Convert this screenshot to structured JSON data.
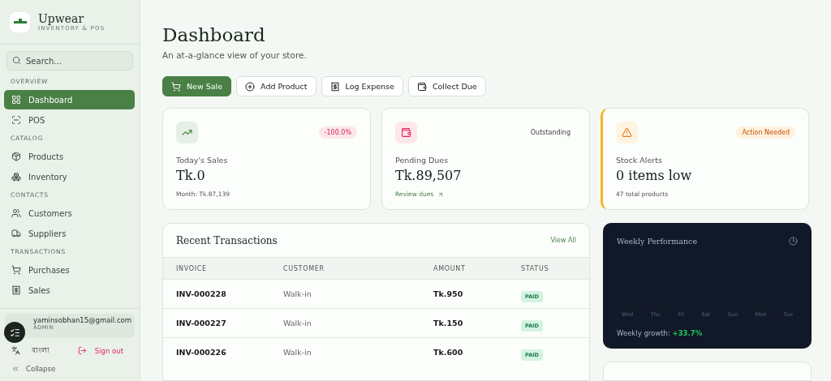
{
  "brand": {
    "name": "Upwear",
    "tagline": "INVENTORY & POS"
  },
  "search": {
    "placeholder": "Search..."
  },
  "nav": [
    {
      "section": "OVERVIEW",
      "items": [
        {
          "label": "Dashboard",
          "selected": true
        },
        {
          "label": "POS",
          "selected": false
        }
      ]
    },
    {
      "section": "CATALOG",
      "items": [
        {
          "label": "Products",
          "selected": false
        },
        {
          "label": "Inventory",
          "selected": false
        }
      ]
    },
    {
      "section": "CONTACTS",
      "items": [
        {
          "label": "Customers",
          "selected": false
        },
        {
          "label": "Suppliers",
          "selected": false
        }
      ]
    },
    {
      "section": "TRANSACTIONS",
      "items": [
        {
          "label": "Purchases",
          "selected": false
        },
        {
          "label": "Sales",
          "selected": false
        }
      ]
    }
  ],
  "user": {
    "email": "yaminsobhan15@gmail.com",
    "role": "ADMIN"
  },
  "language": "বাংলা",
  "sign_out": "Sign out",
  "collapse": "Collapse",
  "page": {
    "title": "Dashboard",
    "subtitle": "An at-a-glance view of your store."
  },
  "actions": [
    {
      "label": "New Sale",
      "kind": "primary"
    },
    {
      "label": "Add Product",
      "kind": "secondary"
    },
    {
      "label": "Log Expense",
      "kind": "secondary"
    },
    {
      "label": "Collect Due",
      "kind": "secondary"
    }
  ],
  "stats": [
    {
      "kind": "sales",
      "badge": "-100.0%",
      "label": "Today's Sales",
      "value": "Tk.0",
      "footer": "Month: Tk.87,139"
    },
    {
      "kind": "dues",
      "badge": "Outstanding",
      "label": "Pending Dues",
      "value": "Tk.89,507",
      "footer": "Review dues"
    },
    {
      "kind": "alert",
      "badge": "Action Needed",
      "label": "Stock Alerts",
      "value": "0 items low",
      "footer": "47 total products"
    }
  ],
  "transactions": {
    "title": "Recent Transactions",
    "view_all": "View All",
    "columns": [
      "INVOICE",
      "CUSTOMER",
      "AMOUNT",
      "STATUS"
    ],
    "rows": [
      {
        "invoice": "INV-000228",
        "customer": "Walk-in",
        "amount": "Tk.950",
        "status": "PAID"
      },
      {
        "invoice": "INV-000227",
        "customer": "Walk-in",
        "amount": "Tk.150",
        "status": "PAID"
      },
      {
        "invoice": "INV-000226",
        "customer": "Walk-in",
        "amount": "Tk.600",
        "status": "PAID"
      }
    ]
  },
  "weekly": {
    "title": "Weekly Performance",
    "days": [
      "Wed",
      "Thu",
      "Fri",
      "Sat",
      "Sun",
      "Mon",
      "Tue"
    ],
    "growth_label": "Weekly growth:",
    "growth": "+33.7%"
  }
}
